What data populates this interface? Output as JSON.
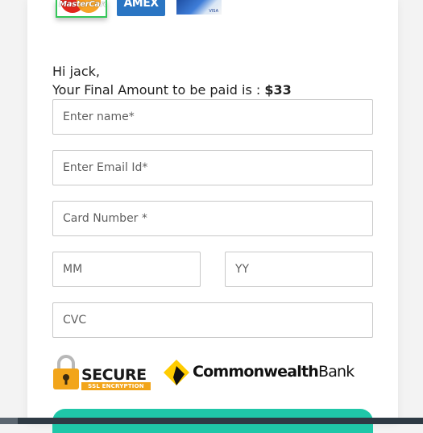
{
  "payment_logos": {
    "mastercard_label": "MasterCard",
    "amex_label": "AMEX",
    "visa_label": "VISA"
  },
  "greeting": "Hi jack,",
  "amount": {
    "prefix": "Your Final Amount to be paid is : ",
    "value": "$33"
  },
  "form": {
    "name_placeholder": "Enter name*",
    "email_placeholder": "Enter Email Id*",
    "card_placeholder": "Card Number *",
    "month_placeholder": "MM",
    "year_placeholder": "YY",
    "cvc_placeholder": "CVC"
  },
  "badges": {
    "secure_word": "SECURE",
    "secure_sub": "SSL ENCRYPTION",
    "bank_bold": "Commonwealth",
    "bank_regular": "Bank"
  },
  "colors": {
    "accent": "#1fc7a8",
    "mastercard_border": "#34c759",
    "amex_blue": "#2a75c3",
    "secure_orange": "#f2a51a",
    "cba_yellow": "#ffcc00"
  }
}
